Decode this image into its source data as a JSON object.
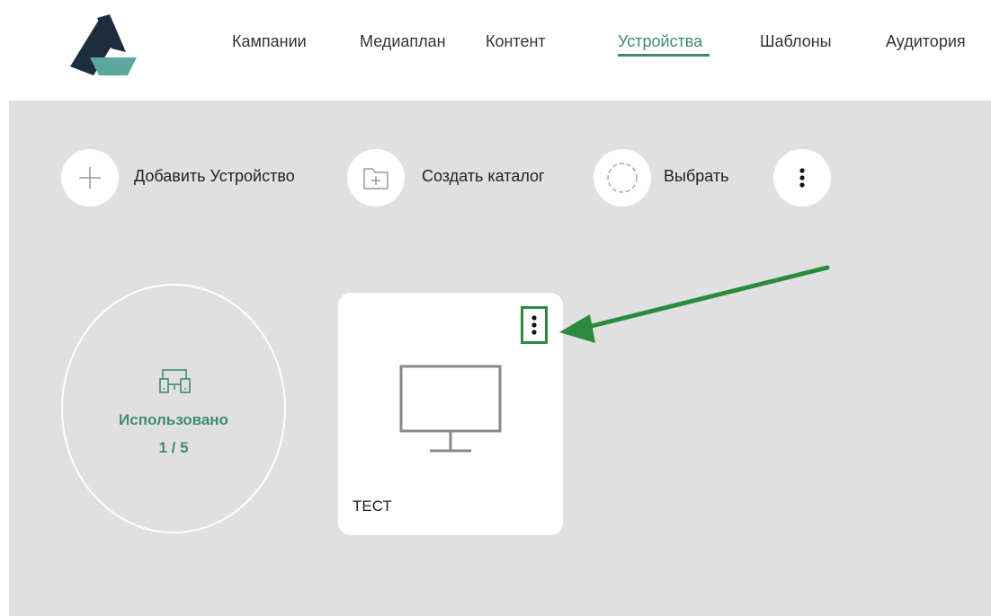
{
  "nav": {
    "items": [
      {
        "label": "Кампании"
      },
      {
        "label": "Медиаплан"
      },
      {
        "label": "Контент"
      },
      {
        "label": "Устройства",
        "active": true
      },
      {
        "label": "Шаблоны"
      },
      {
        "label": "Аудитория"
      }
    ]
  },
  "toolbar": {
    "add_device_label": "Добавить Устройство",
    "create_catalog_label": "Создать каталог",
    "select_label": "Выбрать",
    "more_icon": "more-vertical-icon"
  },
  "usage": {
    "label": "Использовано",
    "value": "1 / 5",
    "icon": "devices-icon"
  },
  "device_card": {
    "title": "ТЕСТ",
    "icon": "monitor-icon",
    "menu_icon": "more-vertical-icon"
  },
  "colors": {
    "accent": "#3f8a76",
    "annotation_green": "#2a8a3e",
    "background": "#e0e0e0"
  }
}
